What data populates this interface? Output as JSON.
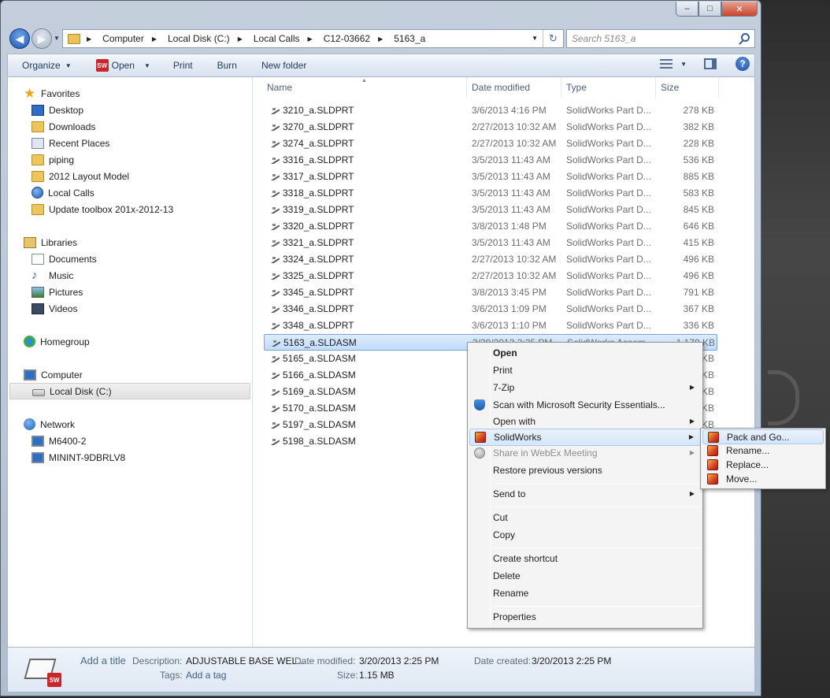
{
  "window": {
    "caption_buttons": [
      "–",
      "□",
      "✕"
    ]
  },
  "nav": {
    "back_icon": "◀",
    "forward_icon": "▶",
    "history_caret": "▼"
  },
  "address": {
    "crumbs": [
      "Computer",
      "Local Disk (C:)",
      "Local Calls",
      "C12-03662",
      "5163_a"
    ],
    "sep": "▶",
    "drop_caret": "▼",
    "refresh_icon": "↻"
  },
  "search": {
    "placeholder": "Search 5163_a"
  },
  "toolbar": {
    "organize": "Organize",
    "open": "Open",
    "print": "Print",
    "burn": "Burn",
    "new_folder": "New folder",
    "caret": "▼",
    "sw_badge": "SW",
    "help": "?"
  },
  "sidebar": {
    "favorites": {
      "label": "Favorites",
      "items": [
        "Desktop",
        "Downloads",
        "Recent Places",
        "piping",
        "2012 Layout Model",
        "Local Calls",
        "Update toolbox 201x-2012-13"
      ]
    },
    "libraries": {
      "label": "Libraries",
      "items": [
        "Documents",
        "Music",
        "Pictures",
        "Videos"
      ]
    },
    "homegroup": "Homegroup",
    "computer": {
      "label": "Computer",
      "items": [
        "Local Disk (C:)"
      ]
    },
    "network": {
      "label": "Network",
      "items": [
        "M6400-2",
        "MININT-9DBRLV8"
      ]
    }
  },
  "columns": {
    "name": "Name",
    "date": "Date modified",
    "type": "Type",
    "size": "Size",
    "sort_caret": "▲"
  },
  "files": [
    {
      "name": "3210_a.SLDPRT",
      "date": "3/6/2013 4:16 PM",
      "type": "SolidWorks Part D...",
      "size": "278 KB"
    },
    {
      "name": "3270_a.SLDPRT",
      "date": "2/27/2013 10:32 AM",
      "type": "SolidWorks Part D...",
      "size": "382 KB"
    },
    {
      "name": "3274_a.SLDPRT",
      "date": "2/27/2013 10:32 AM",
      "type": "SolidWorks Part D...",
      "size": "228 KB"
    },
    {
      "name": "3316_a.SLDPRT",
      "date": "3/5/2013 11:43 AM",
      "type": "SolidWorks Part D...",
      "size": "536 KB"
    },
    {
      "name": "3317_a.SLDPRT",
      "date": "3/5/2013 11:43 AM",
      "type": "SolidWorks Part D...",
      "size": "885 KB"
    },
    {
      "name": "3318_a.SLDPRT",
      "date": "3/5/2013 11:43 AM",
      "type": "SolidWorks Part D...",
      "size": "583 KB"
    },
    {
      "name": "3319_a.SLDPRT",
      "date": "3/5/2013 11:43 AM",
      "type": "SolidWorks Part D...",
      "size": "845 KB"
    },
    {
      "name": "3320_a.SLDPRT",
      "date": "3/8/2013 1:48 PM",
      "type": "SolidWorks Part D...",
      "size": "646 KB"
    },
    {
      "name": "3321_a.SLDPRT",
      "date": "3/5/2013 11:43 AM",
      "type": "SolidWorks Part D...",
      "size": "415 KB"
    },
    {
      "name": "3324_a.SLDPRT",
      "date": "2/27/2013 10:32 AM",
      "type": "SolidWorks Part D...",
      "size": "496 KB"
    },
    {
      "name": "3325_a.SLDPRT",
      "date": "2/27/2013 10:32 AM",
      "type": "SolidWorks Part D...",
      "size": "496 KB"
    },
    {
      "name": "3345_a.SLDPRT",
      "date": "3/8/2013 3:45 PM",
      "type": "SolidWorks Part D...",
      "size": "791 KB"
    },
    {
      "name": "3346_a.SLDPRT",
      "date": "3/6/2013 1:09 PM",
      "type": "SolidWorks Part D...",
      "size": "367 KB"
    },
    {
      "name": "3348_a.SLDPRT",
      "date": "3/6/2013 1:10 PM",
      "type": "SolidWorks Part D...",
      "size": "336 KB"
    },
    {
      "name": "5163_a.SLDASM",
      "date": "3/20/2013 2:25 PM",
      "type": "SolidWorks Assem...",
      "size": "1,179 KB",
      "selected": true
    },
    {
      "name": "5165_a.SLDASM",
      "date": "",
      "type": "",
      "size": "KB"
    },
    {
      "name": "5166_a.SLDASM",
      "date": "",
      "type": "",
      "size": "KB"
    },
    {
      "name": "5169_a.SLDASM",
      "date": "",
      "type": "",
      "size": "KB"
    },
    {
      "name": "5170_a.SLDASM",
      "date": "",
      "type": "",
      "size": "KB"
    },
    {
      "name": "5197_a.SLDASM",
      "date": "",
      "type": "",
      "size": "KB"
    },
    {
      "name": "5198_a.SLDASM",
      "date": "",
      "type": "",
      "size": "KB"
    }
  ],
  "context_menu": {
    "items": [
      "Open",
      "Print",
      "7-Zip",
      "Scan with Microsoft Security Essentials...",
      "Open with",
      "SolidWorks",
      "Share in WebEx Meeting",
      "Restore previous versions",
      "Send to",
      "Cut",
      "Copy",
      "Create shortcut",
      "Delete",
      "Rename",
      "Properties"
    ],
    "arrow": "▶"
  },
  "submenu": {
    "items": [
      "Pack and Go...",
      "Rename...",
      "Replace...",
      "Move..."
    ]
  },
  "details": {
    "title": "Add a title",
    "description_label": "Description:",
    "description": "ADJUSTABLE BASE WEL...",
    "tags_label": "Tags:",
    "tags": "Add a tag",
    "date_modified_label": "Date modified:",
    "date_modified": "3/20/2013 2:25 PM",
    "size_label": "Size:",
    "size": "1.15 MB",
    "date_created_label": "Date created:",
    "date_created": "3/20/2013 2:25 PM",
    "thumb_badge": "SW"
  }
}
